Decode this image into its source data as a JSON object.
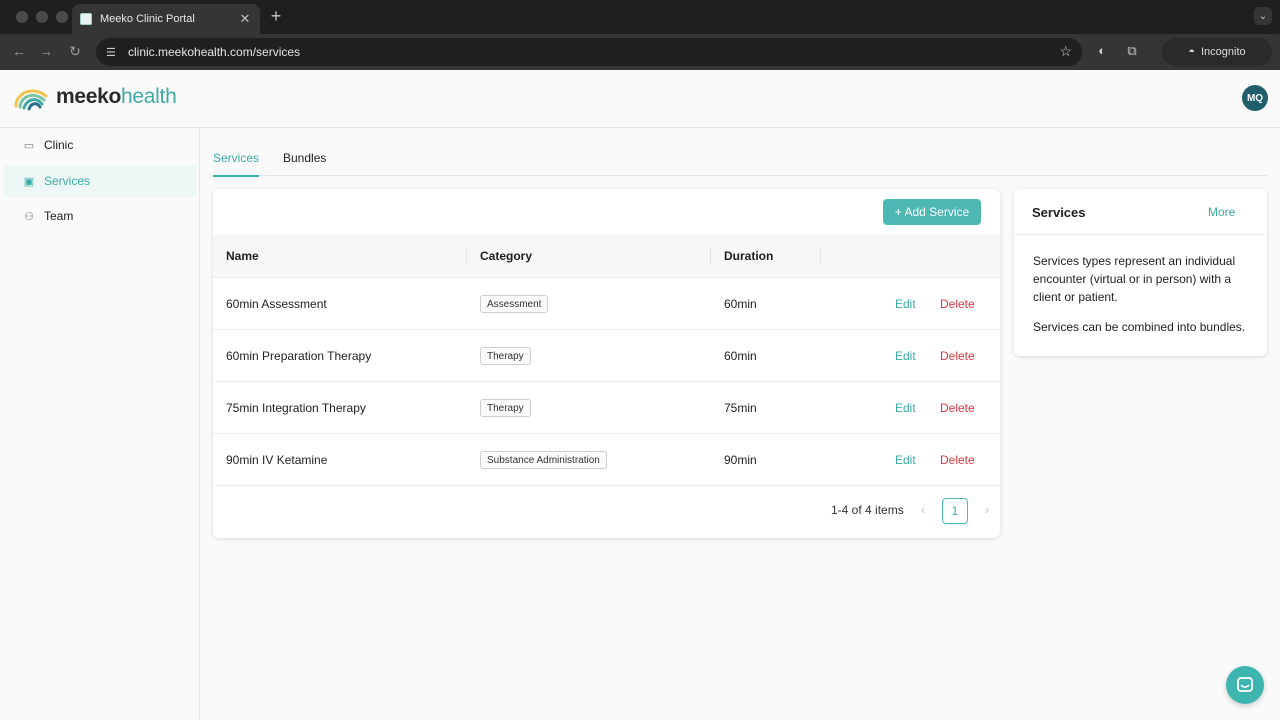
{
  "browser": {
    "tab_title": "Meeko Clinic Portal",
    "tab_close": "✕",
    "new_tab": "+",
    "url": "clinic.meekohealth.com/services",
    "profile_label": "Incognito"
  },
  "app": {
    "logo_part1": "meeko",
    "logo_part2": "health",
    "avatar_initials": "MQ"
  },
  "sidebar": {
    "items": [
      {
        "label": "Clinic",
        "icon": "store-icon"
      },
      {
        "label": "Services",
        "icon": "medical-bag-icon",
        "active": true
      },
      {
        "label": "Team",
        "icon": "team-icon"
      }
    ]
  },
  "tabs": [
    {
      "label": "Services",
      "active": true
    },
    {
      "label": "Bundles",
      "active": false
    }
  ],
  "services_table": {
    "add_button": "+ Add Service",
    "columns": [
      "Name",
      "Category",
      "Duration"
    ],
    "rows": [
      {
        "name": "60min Assessment",
        "category": "Assessment",
        "duration": "60min"
      },
      {
        "name": "60min Preparation Therapy",
        "category": "Therapy",
        "duration": "60min"
      },
      {
        "name": "75min Integration Therapy",
        "category": "Therapy",
        "duration": "75min"
      },
      {
        "name": "90min IV Ketamine",
        "category": "Substance Administration",
        "duration": "90min"
      }
    ],
    "edit_label": "Edit",
    "delete_label": "Delete",
    "pagination": {
      "summary": "1-4 of 4 items",
      "current_page": "1",
      "prev": "‹",
      "next": "›"
    }
  },
  "info_panel": {
    "title": "Services",
    "more_link": "More",
    "paragraph1": "Services types represent an individual encounter (virtual or in person) with a client or patient.",
    "paragraph2": "Services can be combined into bundles."
  },
  "colors": {
    "accent": "#3aaca6",
    "button": "#4cb7b3",
    "danger": "#d9363e",
    "avatar": "#1f5f6b"
  }
}
